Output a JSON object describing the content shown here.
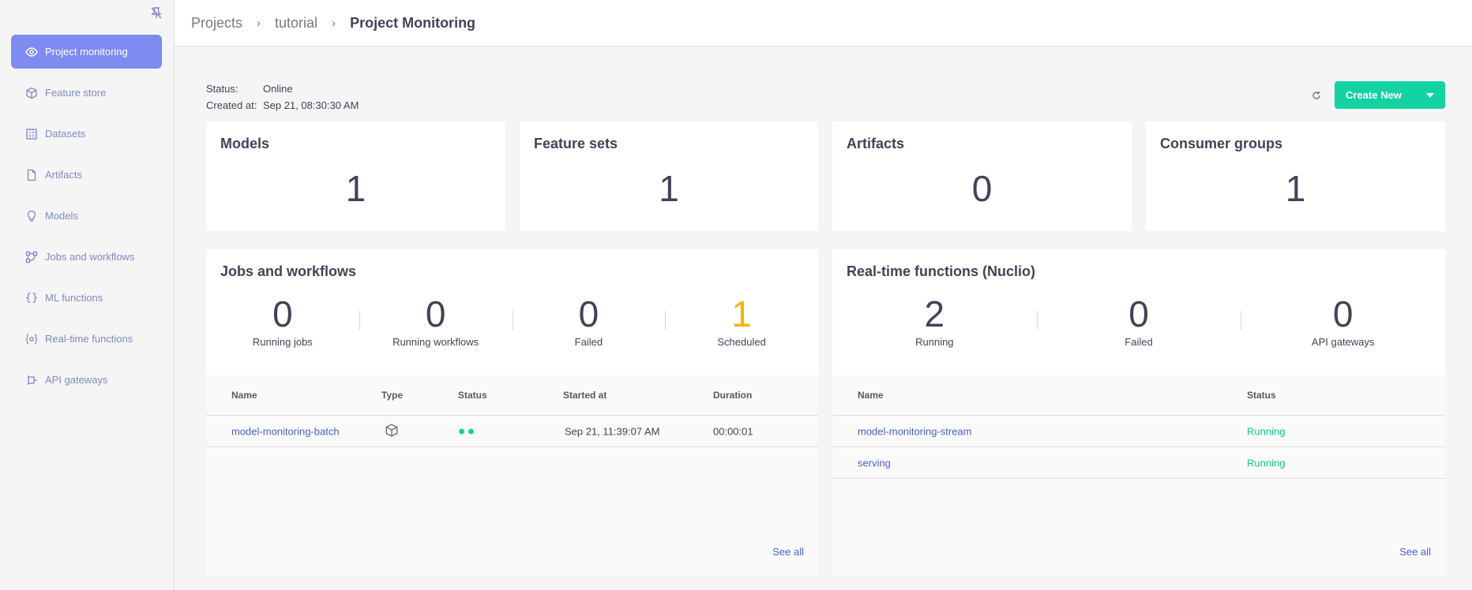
{
  "breadcrumb": {
    "projects": "Projects",
    "project": "tutorial",
    "current": "Project Monitoring"
  },
  "sidebar": {
    "items": [
      {
        "label": "Project monitoring",
        "icon": "eye-icon"
      },
      {
        "label": "Feature store",
        "icon": "cube-icon"
      },
      {
        "label": "Datasets",
        "icon": "grid-icon"
      },
      {
        "label": "Artifacts",
        "icon": "file-icon"
      },
      {
        "label": "Models",
        "icon": "bulb-icon"
      },
      {
        "label": "Jobs and workflows",
        "icon": "workflow-icon"
      },
      {
        "label": "ML functions",
        "icon": "braces-icon"
      },
      {
        "label": "Real-time functions",
        "icon": "gear-brace-icon"
      },
      {
        "label": "API gateways",
        "icon": "gateway-icon"
      }
    ]
  },
  "status": {
    "status_key": "Status:",
    "status_value": "Online",
    "created_key": "Created at:",
    "created_value": "Sep 21, 08:30:30 AM"
  },
  "actions": {
    "create_new": "Create New"
  },
  "summary_cards": [
    {
      "title": "Models",
      "value": "1"
    },
    {
      "title": "Feature sets",
      "value": "1"
    },
    {
      "title": "Artifacts",
      "value": "0"
    },
    {
      "title": "Consumer groups",
      "value": "1"
    }
  ],
  "jobs_panel": {
    "title": "Jobs and workflows",
    "stats": [
      {
        "value": "0",
        "label": "Running jobs"
      },
      {
        "value": "0",
        "label": "Running workflows"
      },
      {
        "value": "0",
        "label": "Failed"
      },
      {
        "value": "1",
        "label": "Scheduled"
      }
    ],
    "columns": {
      "name": "Name",
      "type": "Type",
      "status": "Status",
      "started": "Started at",
      "duration": "Duration"
    },
    "rows": [
      {
        "name": "model-monitoring-batch",
        "started": "Sep 21, 11:39:07 AM",
        "duration": "00:00:01"
      }
    ],
    "see_all": "See all"
  },
  "functions_panel": {
    "title": "Real-time functions (Nuclio)",
    "stats": [
      {
        "value": "2",
        "label": "Running"
      },
      {
        "value": "0",
        "label": "Failed"
      },
      {
        "value": "0",
        "label": "API gateways"
      }
    ],
    "columns": {
      "name": "Name",
      "status": "Status"
    },
    "rows": [
      {
        "name": "model-monitoring-stream",
        "status": "Running"
      },
      {
        "name": "serving",
        "status": "Running"
      }
    ],
    "see_all": "See all"
  },
  "colors": {
    "accent": "#7f8bf0",
    "primary_button": "#13d3a3",
    "link": "#4a5fcf",
    "running": "#13c48f",
    "scheduled": "#f4b400"
  }
}
